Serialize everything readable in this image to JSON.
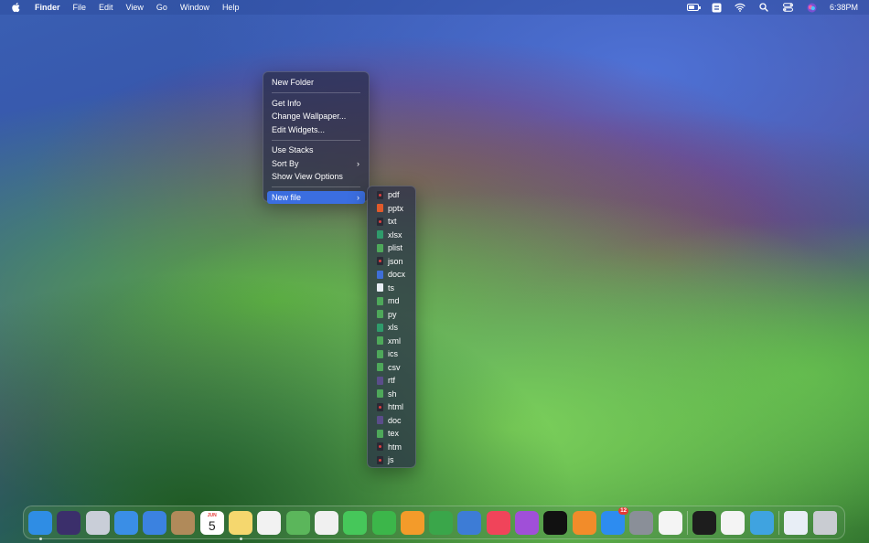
{
  "menubar": {
    "app_name": "Finder",
    "menus": [
      "File",
      "Edit",
      "View",
      "Go",
      "Window",
      "Help"
    ],
    "clock": "6:38PM"
  },
  "context_menu": {
    "new_folder": "New Folder",
    "get_info": "Get Info",
    "change_wallpaper": "Change Wallpaper...",
    "edit_widgets": "Edit Widgets...",
    "use_stacks": "Use Stacks",
    "sort_by": "Sort By",
    "show_view_options": "Show View Options",
    "new_file": "New file",
    "submenu_chevron": "›"
  },
  "new_file_types": [
    {
      "label": "pdf",
      "icon": "red"
    },
    {
      "label": "pptx",
      "icon": "orange"
    },
    {
      "label": "txt",
      "icon": "red"
    },
    {
      "label": "xlsx",
      "icon": "teal"
    },
    {
      "label": "plist",
      "icon": "green"
    },
    {
      "label": "json",
      "icon": "red"
    },
    {
      "label": "docx",
      "icon": "blue"
    },
    {
      "label": "ts",
      "icon": "white"
    },
    {
      "label": "md",
      "icon": "green"
    },
    {
      "label": "py",
      "icon": "green"
    },
    {
      "label": "xls",
      "icon": "teal"
    },
    {
      "label": "xml",
      "icon": "green"
    },
    {
      "label": "ics",
      "icon": "green"
    },
    {
      "label": "csv",
      "icon": "green"
    },
    {
      "label": "rtf",
      "icon": "purple"
    },
    {
      "label": "sh",
      "icon": "green"
    },
    {
      "label": "html",
      "icon": "red"
    },
    {
      "label": "doc",
      "icon": "purple"
    },
    {
      "label": "tex",
      "icon": "green"
    },
    {
      "label": "htm",
      "icon": "red"
    },
    {
      "label": "js",
      "icon": "red"
    }
  ],
  "dock": {
    "calendar_month": "JUN",
    "calendar_day": "5",
    "appstore_badge": "12",
    "apps": [
      {
        "name": "finder",
        "color": "#2f8de4"
      },
      {
        "name": "siri",
        "color": "#3b2f6b"
      },
      {
        "name": "launchpad",
        "color": "#c9ced8"
      },
      {
        "name": "safari",
        "color": "#3a8ee6"
      },
      {
        "name": "mail",
        "color": "#3b82e0"
      },
      {
        "name": "contacts",
        "color": "#b08a5a"
      },
      {
        "name": "calendar",
        "color": "#ffffff"
      },
      {
        "name": "notes",
        "color": "#f5d76e"
      },
      {
        "name": "reminders",
        "color": "#f2f2f2"
      },
      {
        "name": "maps",
        "color": "#5bb65b"
      },
      {
        "name": "photos",
        "color": "#f0f0f0"
      },
      {
        "name": "messages",
        "color": "#46c75a"
      },
      {
        "name": "facetime",
        "color": "#3cb64a"
      },
      {
        "name": "pages",
        "color": "#f39b2a"
      },
      {
        "name": "numbers",
        "color": "#3aa64a"
      },
      {
        "name": "keynote",
        "color": "#3d7cd6"
      },
      {
        "name": "music",
        "color": "#f0445a"
      },
      {
        "name": "podcasts",
        "color": "#a04fd8"
      },
      {
        "name": "tv",
        "color": "#111111"
      },
      {
        "name": "books",
        "color": "#f28c2a"
      },
      {
        "name": "app-store",
        "color": "#2d8cf0"
      },
      {
        "name": "system-settings",
        "color": "#8a8f98"
      },
      {
        "name": "chrome",
        "color": "#f4f4f4"
      },
      {
        "name": "terminal",
        "color": "#1d1d1d"
      },
      {
        "name": "qq",
        "color": "#f4f4f4"
      },
      {
        "name": "telegram",
        "color": "#3fa3e0"
      },
      {
        "name": "documents-folder",
        "color": "#e8eef6"
      },
      {
        "name": "trash",
        "color": "#c9ccd2"
      }
    ]
  }
}
